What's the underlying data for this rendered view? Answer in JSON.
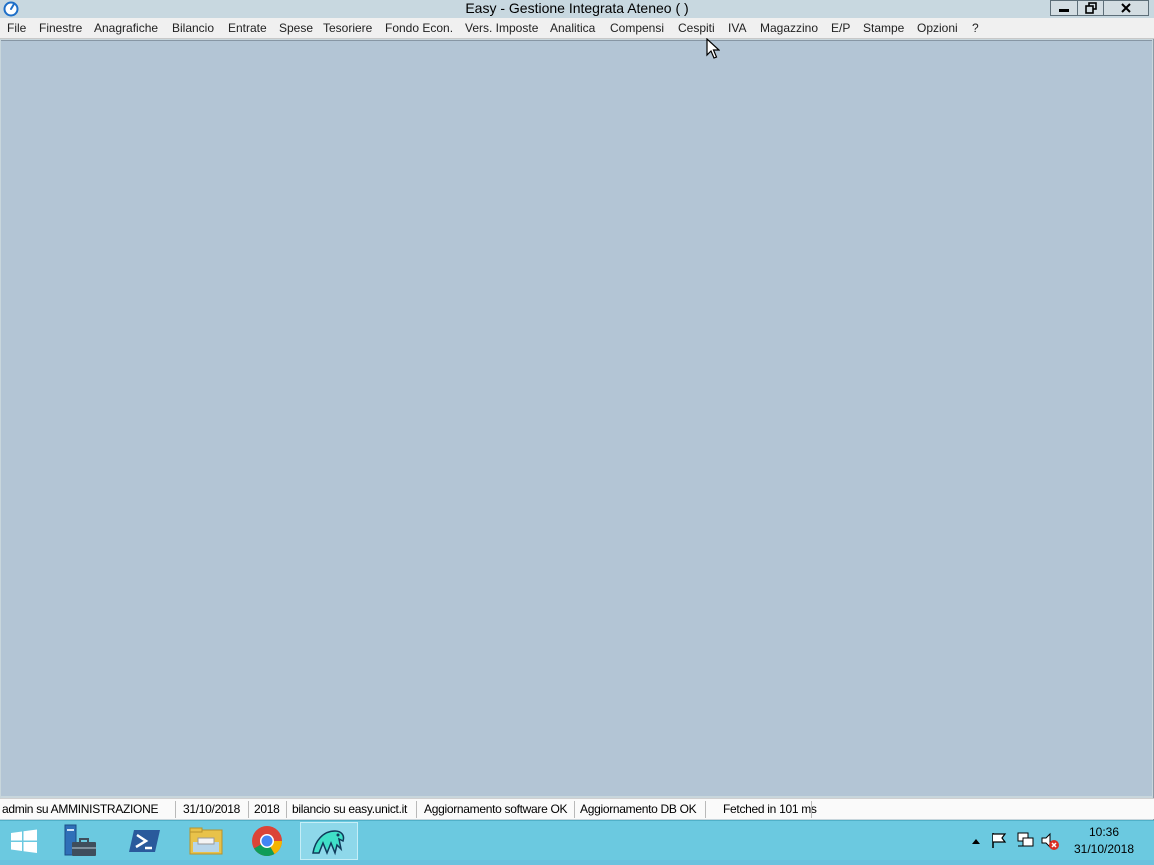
{
  "window": {
    "title": "Easy - Gestione Integrata Ateneo (  )"
  },
  "menu": {
    "items": [
      {
        "label": "File"
      },
      {
        "label": "Finestre"
      },
      {
        "label": "Anagrafiche"
      },
      {
        "label": "Bilancio"
      },
      {
        "label": "Entrate"
      },
      {
        "label": "Spese"
      },
      {
        "label": "Tesoriere"
      },
      {
        "label": "Fondo Econ."
      },
      {
        "label": "Vers. Imposte"
      },
      {
        "label": "Analitica"
      },
      {
        "label": "Compensi"
      },
      {
        "label": "Cespiti"
      },
      {
        "label": "IVA"
      },
      {
        "label": "Magazzino"
      },
      {
        "label": "E/P"
      },
      {
        "label": "Stampe"
      },
      {
        "label": "Opzioni"
      },
      {
        "label": "?"
      }
    ]
  },
  "status": {
    "user": "admin su AMMINISTRAZIONE",
    "date": "31/10/2018",
    "year": "2018",
    "db": "bilancio su easy.unict.it",
    "software_update": "Aggiornamento software OK",
    "db_update": "Aggiornamento DB OK",
    "fetch": "Fetched in 101 ms"
  },
  "taskbar": {
    "icons": [
      "windows-start-icon",
      "server-manager-icon",
      "powershell-icon",
      "file-explorer-icon",
      "chrome-icon",
      "easy-app-icon"
    ],
    "clock_time": "10:36",
    "clock_date": "31/10/2018"
  },
  "colors": {
    "client_bg": "#b3c5d5",
    "taskbar_bg": "#6bc9e0",
    "titlebar_bg": "#c8d8e0"
  }
}
